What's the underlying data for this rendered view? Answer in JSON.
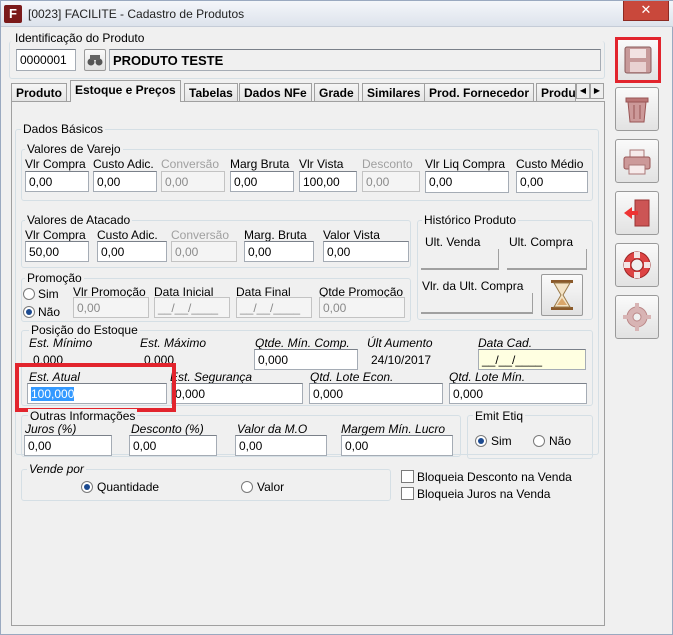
{
  "window": {
    "title": "[0023] FACILITE - Cadastro de Produtos",
    "close_glyph": "✕"
  },
  "product": {
    "section_label": "Identificação do Produto",
    "code": "0000001",
    "name": "PRODUTO TESTE"
  },
  "tabs": [
    {
      "label": "Produto"
    },
    {
      "label": "Estoque e Preços"
    },
    {
      "label": "Tabelas"
    },
    {
      "label": "Dados NFe"
    },
    {
      "label": "Grade"
    },
    {
      "label": "Similares"
    },
    {
      "label": "Prod. Fornecedor"
    },
    {
      "label": "Produ"
    }
  ],
  "active_tab": "Estoque e Preços",
  "dados_basicos": {
    "title": "Dados Básicos"
  },
  "varejo": {
    "title": "Valores de Varejo",
    "fields": [
      {
        "label": "Vlr Compra",
        "value": "0,00"
      },
      {
        "label": "Custo Adic.",
        "value": "0,00"
      },
      {
        "label": "Conversão",
        "value": "0,00"
      },
      {
        "label": "Marg Bruta",
        "value": "0,00"
      },
      {
        "label": "Vlr Vista",
        "value": "100,00"
      },
      {
        "label": "Desconto",
        "value": "0,00"
      },
      {
        "label": "Vlr Liq Compra",
        "value": "0,00"
      },
      {
        "label": "Custo Médio",
        "value": "0,00"
      }
    ]
  },
  "atacado": {
    "title": "Valores de Atacado",
    "fields": [
      {
        "label": "Vlr Compra",
        "value": "50,00"
      },
      {
        "label": "Custo Adic.",
        "value": "0,00"
      },
      {
        "label": "Conversão",
        "value": "0,00"
      },
      {
        "label": "Marg. Bruta",
        "value": "0,00"
      },
      {
        "label": "Valor Vista",
        "value": "0,00"
      }
    ]
  },
  "historico": {
    "title": "Histórico Produto",
    "ult_venda": "Ult. Venda",
    "ult_compra": "Ult. Compra",
    "vlr_ult_compra": "Vlr. da Ult. Compra"
  },
  "promocao": {
    "title": "Promoção",
    "opt_sim": "Sim",
    "opt_nao": "Não",
    "selected": "Não",
    "vlr_label": "Vlr Promoção",
    "vlr_value": "0,00",
    "data_inicial_label": "Data Inicial",
    "data_inicial_value": "__/__/____",
    "data_final_label": "Data Final",
    "data_final_value": "__/__/____",
    "qtde_label": "Qtde Promoção",
    "qtde_value": "0,00"
  },
  "posicao": {
    "title": "Posição do Estoque",
    "est_minimo_label": "Est. Mínimo",
    "est_minimo_value": "0,000",
    "est_maximo_label": "Est. Máximo",
    "est_maximo_value": "0,000",
    "qtde_min_comp_label": "Qtde. Mín. Comp.",
    "qtde_min_comp_value": "0,000",
    "ult_aumento_label": "Últ Aumento",
    "ult_aumento_value": "24/10/2017",
    "data_cad_label": "Data Cad.",
    "data_cad_value": "__/__/____",
    "est_atual_label": "Est. Atual",
    "est_atual_value": "100,000",
    "est_seguranca_label": "Est. Segurança",
    "est_seguranca_value": "0,000",
    "qtd_lote_econ_label": "Qtd. Lote Econ.",
    "qtd_lote_econ_value": "0,000",
    "qtd_lote_min_label": "Qtd. Lote Mín.",
    "qtd_lote_min_value": "0,000"
  },
  "outras": {
    "title": "Outras Informações",
    "juros_label": "Juros (%)",
    "juros_value": "0,00",
    "desconto_label": "Desconto (%)",
    "desconto_value": "0,00",
    "valor_mo_label": "Valor da M.O",
    "valor_mo_value": "0,00",
    "margem_label": "Margem Mín. Lucro",
    "margem_value": "0,00"
  },
  "emit_etiq": {
    "title": "Emit Etiq",
    "opt_sim": "Sim",
    "opt_nao": "Não",
    "selected": "Sim"
  },
  "vende_por": {
    "title": "Vende por",
    "opt_quantidade": "Quantidade",
    "opt_valor": "Valor",
    "selected": "Quantidade"
  },
  "checks": {
    "bloqueia_desconto": "Bloqueia Desconto na Venda",
    "bloqueia_juros": "Bloqueia Juros na Venda"
  },
  "colors": {
    "highlight": "#e2242d",
    "selection": "#3399ff",
    "close": "#c9483b"
  },
  "toolbar": [
    {
      "icon": "floppy-save-icon"
    },
    {
      "icon": "trash-icon"
    },
    {
      "icon": "printer-icon"
    },
    {
      "icon": "exit-door-icon"
    },
    {
      "icon": "lifebuoy-help-icon"
    },
    {
      "icon": "gear-settings-icon"
    }
  ]
}
